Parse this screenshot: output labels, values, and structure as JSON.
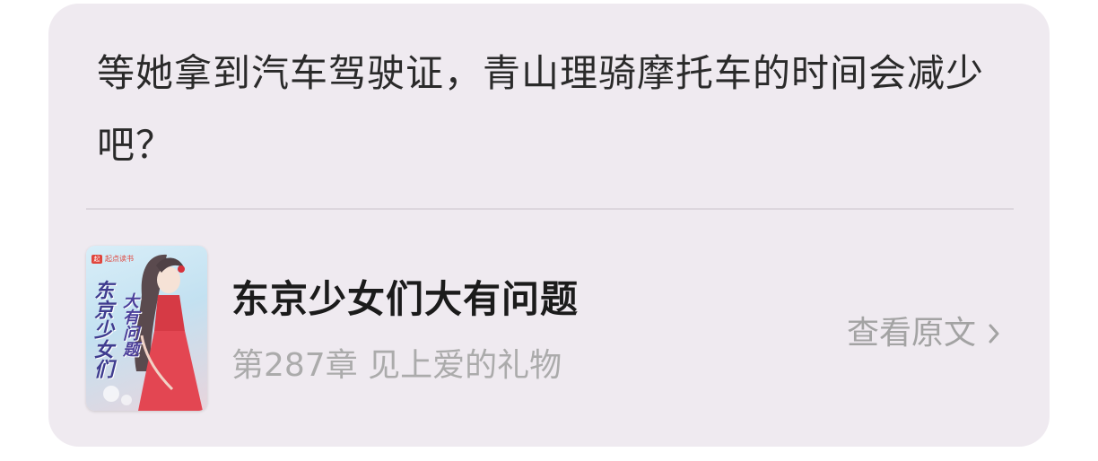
{
  "quote": {
    "text": "等她拿到汽车驾驶证，青山理骑摩托车的时间会减少吧？"
  },
  "book": {
    "title": "东京少女们大有问题",
    "chapter": "第287章 见上爱的礼物",
    "view_original_label": "查看原文",
    "cover": {
      "brand_logo": "起",
      "brand_text": "起点读书",
      "title_part1": "东京少女们",
      "title_part2": "大有问题"
    }
  },
  "icons": {
    "chevron": "chevron-right-icon"
  },
  "colors": {
    "card_background": "#efeaf0",
    "quote_text": "#2a2a2a",
    "title_text": "#1b1b1b",
    "secondary_text": "#ababab",
    "cover_red": "#e0453c"
  }
}
